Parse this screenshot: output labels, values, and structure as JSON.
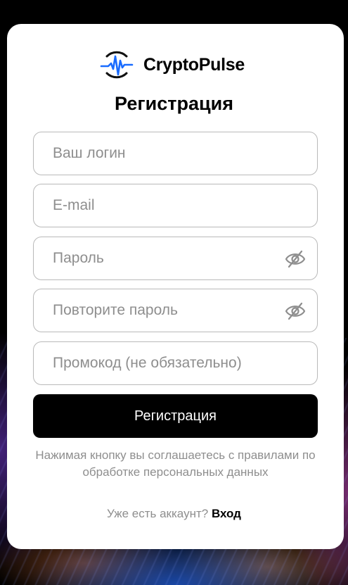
{
  "brand": {
    "name": "CryptoPulse",
    "logo_icon": "pulse-circle-icon",
    "accent_color": "#1a6cff"
  },
  "form": {
    "title": "Регистрация",
    "login_placeholder": "Ваш логин",
    "email_placeholder": "E-mail",
    "password_placeholder": "Пароль",
    "password_repeat_placeholder": "Повторите пароль",
    "promo_placeholder": "Промокод (не обязательно)",
    "submit_label": "Регистрация",
    "eye_icon": "eye-off-icon",
    "terms_text": "Нажимая кнопку вы соглашаетесь с правилами по обработке персональных данных",
    "have_account_text": "Уже есть аккаунт?",
    "login_link_label": "Вход"
  }
}
